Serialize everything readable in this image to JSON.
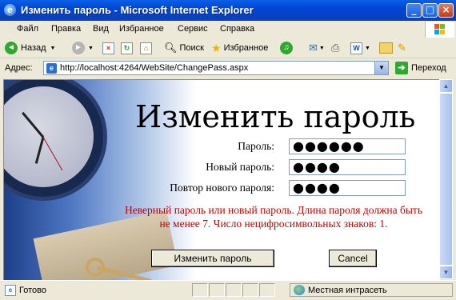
{
  "window": {
    "title": "Изменить пароль - Microsoft Internet Explorer",
    "ie_icon": "ie-logo-icon",
    "controls": {
      "minimize": "_",
      "maximize": "□",
      "close": "×"
    }
  },
  "menu": {
    "items": [
      "Файл",
      "Правка",
      "Вид",
      "Избранное",
      "Сервис",
      "Справка"
    ]
  },
  "toolbar": {
    "back_label": "Назад",
    "search_label": "Поиск",
    "favorites_label": "Избранное"
  },
  "address": {
    "label": "Адрес:",
    "url": "http://localhost:4264/WebSite/ChangePass.aspx",
    "go_label": "Переход"
  },
  "page": {
    "heading": "Изменить пароль",
    "password_label": "Пароль:",
    "password_value": "●●●●●●",
    "new_password_label": "Новый пароль:",
    "new_password_value": "●●●●",
    "confirm_label": "Повтор нового пароля:",
    "confirm_value": "●●●●",
    "error_text": "Неверный пароль или новый пароль. Длина пароля должна быть не менее 7. Число нецифросимвольных знаков: 1.",
    "change_button": "Изменить пароль",
    "cancel_button": "Cancel"
  },
  "status": {
    "text": "Готово",
    "zone": "Местная интрасеть"
  },
  "colors": {
    "titlebar": "#0046D5",
    "error": "#C00000",
    "chrome": "#ECE9D8"
  }
}
